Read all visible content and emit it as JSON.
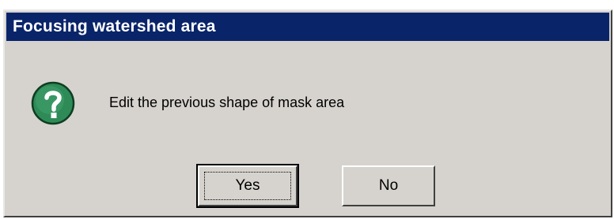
{
  "dialog": {
    "title": "Focusing watershed area",
    "message": "Edit the previous shape of mask area",
    "icon": "question-icon",
    "buttons": {
      "yes_label": "Yes",
      "no_label": "No"
    },
    "colors": {
      "title_bar": "#0a246a",
      "face": "#d6d3ce",
      "icon_fill": "#2e8b57"
    }
  }
}
